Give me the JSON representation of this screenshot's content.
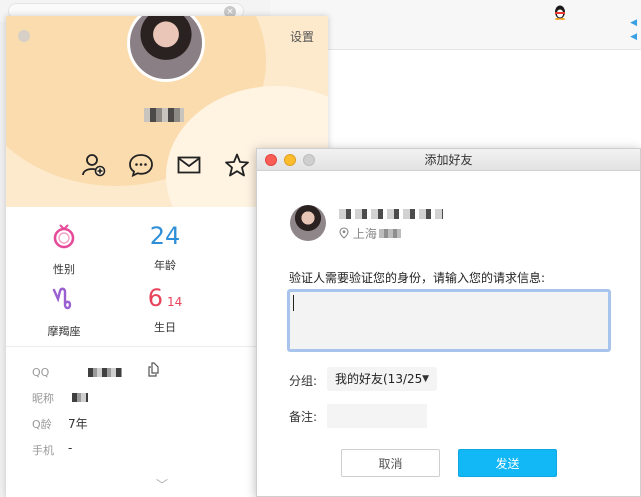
{
  "profile": {
    "settings_label": "设置",
    "actions": [
      "add-contact-icon",
      "chat-icon",
      "mail-icon",
      "star-icon"
    ],
    "stats": {
      "gender_label": "性别",
      "age_value": "24",
      "age_label": "年龄",
      "zodiac_label": "摩羯座",
      "birthday_month": "6",
      "birthday_day": "14",
      "birthday_label": "生日"
    },
    "info": {
      "qq_label": "QQ",
      "nickname_label": "昵称",
      "qq_age_label": "Q龄",
      "qq_age_value": "7年",
      "phone_label": "手机",
      "phone_value": "-"
    }
  },
  "dialog": {
    "title": "添加好友",
    "location": "上海",
    "prompt": "验证人需要验证您的身份，请输入您的请求信息:",
    "message_value": "",
    "group_label": "分组:",
    "group_value": "我的好友(13/25",
    "remark_label": "备注:",
    "remark_value": "",
    "cancel_label": "取消",
    "send_label": "发送"
  },
  "colors": {
    "accent": "#12b7f5",
    "card_header": "#fde9cc",
    "close": "#fc5d57",
    "minimize": "#fdbc2e",
    "maximize_disabled": "#cfcfcf",
    "gender_icon": "#e64b9a",
    "age_number": "#2e8fd8",
    "zodiac_icon": "#9a5fd0",
    "birthday_number": "#e8435a"
  }
}
